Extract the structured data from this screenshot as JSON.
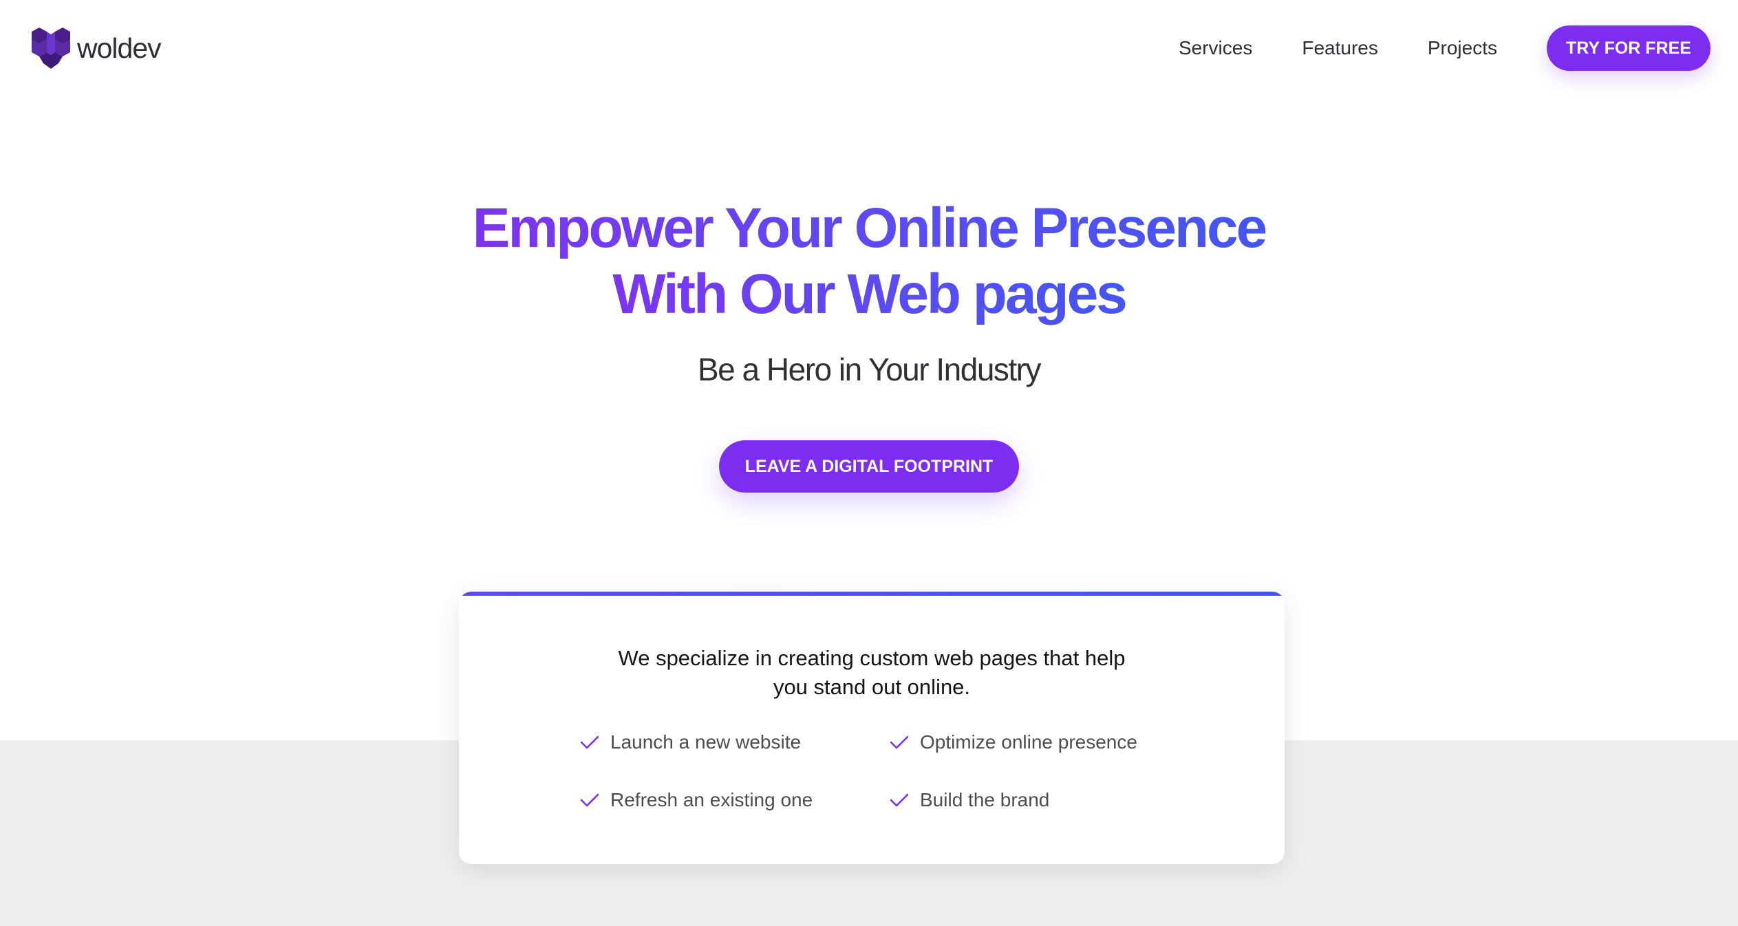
{
  "brand": {
    "name": "woldev",
    "logo_icon": "w-diamond-logo-icon",
    "accent_color": "#7c2df0"
  },
  "nav": {
    "links": [
      "Services",
      "Features",
      "Projects"
    ],
    "cta_label": "TRY FOR FREE"
  },
  "hero": {
    "title_line1": "Empower Your Online Presence",
    "title_line2": "With Our Web pages",
    "subtitle": "Be a Hero in Your Industry",
    "cta_label": "LEAVE A DIGITAL FOOTPRINT",
    "gradient_colors": [
      "#7d34ee",
      "#4456ef"
    ]
  },
  "card": {
    "intro_line1": "We specialize in creating custom web pages that help",
    "intro_line2": "you stand out online.",
    "check_icon": "check-icon",
    "features": [
      "Launch a new website",
      "Optimize online presence",
      "Refresh an existing one",
      "Build the brand"
    ]
  }
}
